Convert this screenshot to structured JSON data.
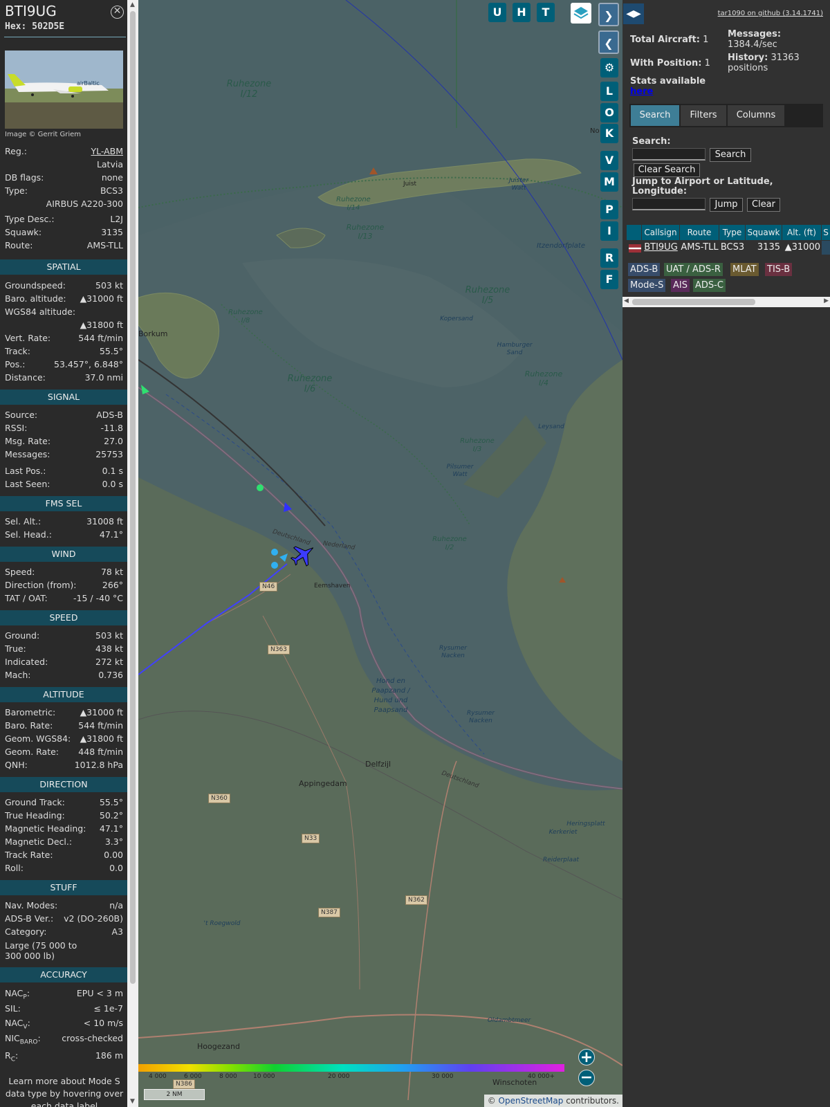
{
  "aircraft": {
    "callsign": "BTI9UG",
    "hex_label": "Hex: 502D5E",
    "photo_caption": "Image © Gerrit Griem",
    "reg_label": "Reg.:",
    "reg": "YL-ABM",
    "country": "Latvia",
    "dbflags_label": "DB flags:",
    "dbflags": "none",
    "type_label": "Type:",
    "type": "BCS3",
    "type_full": "AIRBUS A220-300",
    "typedesc_label": "Type Desc.:",
    "typedesc": "L2J",
    "squawk_label": "Squawk:",
    "squawk": "3135",
    "route_label": "Route:",
    "route": "AMS-TLL"
  },
  "sections": {
    "spatial": "SPATIAL",
    "signal": "SIGNAL",
    "fms": "FMS SEL",
    "wind": "WIND",
    "speed": "SPEED",
    "altitude": "ALTITUDE",
    "direction": "DIRECTION",
    "stuff": "STUFF",
    "accuracy": "ACCURACY"
  },
  "spatial": [
    {
      "k": "Groundspeed:",
      "v": "503 kt"
    },
    {
      "k": "Baro. altitude:",
      "v": "▲31000 ft"
    },
    {
      "k": "WGS84 altitude:",
      "v": ""
    },
    {
      "k": "",
      "v": "▲31800 ft"
    },
    {
      "k": "Vert. Rate:",
      "v": "544 ft/min"
    },
    {
      "k": "Track:",
      "v": "55.5°"
    },
    {
      "k": "Pos.:",
      "v": "53.457°, 6.848°"
    },
    {
      "k": "Distance:",
      "v": "37.0 nmi"
    }
  ],
  "signal": [
    {
      "k": "Source:",
      "v": "ADS-B"
    },
    {
      "k": "RSSI:",
      "v": "-11.8"
    },
    {
      "k": "Msg. Rate:",
      "v": "27.0"
    },
    {
      "k": "Messages:",
      "v": "25753"
    },
    {
      "k": "Last Pos.:",
      "v": "0.1 s"
    },
    {
      "k": "Last Seen:",
      "v": "0.0 s"
    }
  ],
  "fms": [
    {
      "k": "Sel. Alt.:",
      "v": "31008 ft"
    },
    {
      "k": "Sel. Head.:",
      "v": "47.1°"
    }
  ],
  "wind": [
    {
      "k": "Speed:",
      "v": "78 kt"
    },
    {
      "k": "Direction (from):",
      "v": "266°"
    },
    {
      "k": "TAT / OAT:",
      "v": "-15 / -40 °C"
    }
  ],
  "speed": [
    {
      "k": "Ground:",
      "v": "503 kt"
    },
    {
      "k": "True:",
      "v": "438 kt"
    },
    {
      "k": "Indicated:",
      "v": "272 kt"
    },
    {
      "k": "Mach:",
      "v": "0.736"
    }
  ],
  "altitude": [
    {
      "k": "Barometric:",
      "v": "▲31000 ft"
    },
    {
      "k": "Baro. Rate:",
      "v": "544 ft/min"
    },
    {
      "k": "Geom. WGS84:",
      "v": "▲31800 ft"
    },
    {
      "k": "Geom. Rate:",
      "v": "448 ft/min"
    },
    {
      "k": "QNH:",
      "v": "1012.8 hPa"
    }
  ],
  "direction": [
    {
      "k": "Ground Track:",
      "v": "55.5°"
    },
    {
      "k": "True Heading:",
      "v": "50.2°"
    },
    {
      "k": "Magnetic Heading:",
      "v": "47.1°"
    },
    {
      "k": "Magnetic Decl.:",
      "v": "3.3°"
    },
    {
      "k": "Track Rate:",
      "v": "0.00"
    },
    {
      "k": "Roll:",
      "v": "0.0"
    }
  ],
  "stuff": [
    {
      "k": "Nav. Modes:",
      "v": "n/a"
    },
    {
      "k": "ADS-B Ver.:",
      "v": "v2 (DO-260B)"
    },
    {
      "k": "Category:",
      "v": "A3"
    },
    {
      "k": "Large (75 000 to",
      "v": ""
    },
    {
      "k": "300 000 lb)",
      "v": ""
    }
  ],
  "accuracy": {
    "nacp_k": "NAC",
    "nacp_sub": "P",
    "nacp_v": "EPU < 3 m",
    "sil_k": "SIL:",
    "sil_v": "≤ 1e-7",
    "nacv_k": "NAC",
    "nacv_sub": "V",
    "nacv_v": "< 10 m/s",
    "nicbaro_k": "NIC",
    "nicbaro_sub": "BARO",
    "nicbaro_v": "cross-checked",
    "rc_k": "R",
    "rc_sub": "C",
    "rc_v": "186 m"
  },
  "footer_text": "Learn more about Mode S data type by hovering over each data label",
  "map": {
    "buttons": {
      "u": "U",
      "h": "H",
      "t": "T",
      "l": "L",
      "o": "O",
      "k": "K",
      "v": "V",
      "m": "M",
      "p": "P",
      "i": "I",
      "r": "R",
      "f": "F"
    },
    "labels": {
      "rz12": "Ruhezone I/12",
      "rz14": "Ruhezone I/14",
      "rz13": "Ruhezone I/13",
      "rz5": "Ruhezone I/5",
      "rz8": "Ruhezone I/8",
      "rz6": "Ruhezone I/6",
      "rz4": "Ruhezone I/4",
      "rz3": "Ruhezone I/3",
      "rz2": "Ruhezone I/2",
      "juist": "Juist",
      "borkum": "Borkum",
      "delfzijl": "Delfzijl",
      "appingedam": "Appingedam",
      "eemshaven": "Eemshaven",
      "hoogezand": "Hoogezand",
      "winschoten": "Winschoten",
      "itzendorf": "Itzendorfplate",
      "kopersand": "Kopersand",
      "hamburger": "Hamburger Sand",
      "leysand": "Leysand",
      "pilsumer": "Pilsumer Watt",
      "rysumer": "Rysumer Nacken",
      "hond": "Hond en Paapzand / Hund und Paapsand",
      "rysumer2": "Rysumer Nacken",
      "heringsplatt": "Heringsplatt",
      "kerkeriet": "Kerkeriet",
      "reiderplaat": "Reiderplaat",
      "roegwold": "'t Roegwold",
      "oldambt": "Oldambtmeer",
      "deutschland": "Deutschland",
      "nederland": "Nederland",
      "deutschland2": "Deutschland",
      "juister": "Juister Watt",
      "no": "No"
    },
    "roads": {
      "n46": "N46",
      "n363": "N363",
      "n360": "N360",
      "n33": "N33",
      "n387": "N387",
      "n362": "N362",
      "n386": "N386"
    },
    "alt_legend": [
      "4 000",
      "6 000",
      "8 000",
      "10 000",
      "20 000",
      "30 000",
      "40 000+"
    ],
    "scale": "2 NM",
    "attribution_prefix": "© ",
    "attribution_link": "OpenStreetMap",
    "attribution_suffix": " contributors."
  },
  "panel": {
    "github_link": "tar1090 on github (3.14.1741)",
    "total_aircraft_label": "Total Aircraft:",
    "total_aircraft": "1",
    "with_position_label": "With Position:",
    "with_position": "1",
    "messages_label": "Messages:",
    "messages": "1384.4/sec",
    "history_label": "History:",
    "history": "31363 positions",
    "stats_label": "Stats available",
    "stats_link": "here",
    "tabs": [
      "Search",
      "Filters",
      "Columns"
    ],
    "search_label": "Search:",
    "search_btn": "Search",
    "clear_search_btn": "Clear Search",
    "jump_label": "Jump to Airport or Latitude, Longitude:",
    "jump_btn": "Jump",
    "clear_btn": "Clear",
    "columns": [
      "Callsign",
      "Route",
      "Type",
      "Squawk",
      "Alt. (ft)",
      "S"
    ],
    "row": {
      "callsign": "BTI9UG",
      "route": "AMS-TLL",
      "type": "BCS3",
      "squawk": "3135",
      "alt": "▲31000"
    },
    "sources": [
      "ADS-B",
      "UAT / ADS-R",
      "MLAT",
      "TIS-B",
      "Mode-S",
      "AIS",
      "ADS-C"
    ]
  },
  "colors": {
    "header": "#164a5a",
    "button": "#005f78",
    "accent": "#3e7e96"
  }
}
